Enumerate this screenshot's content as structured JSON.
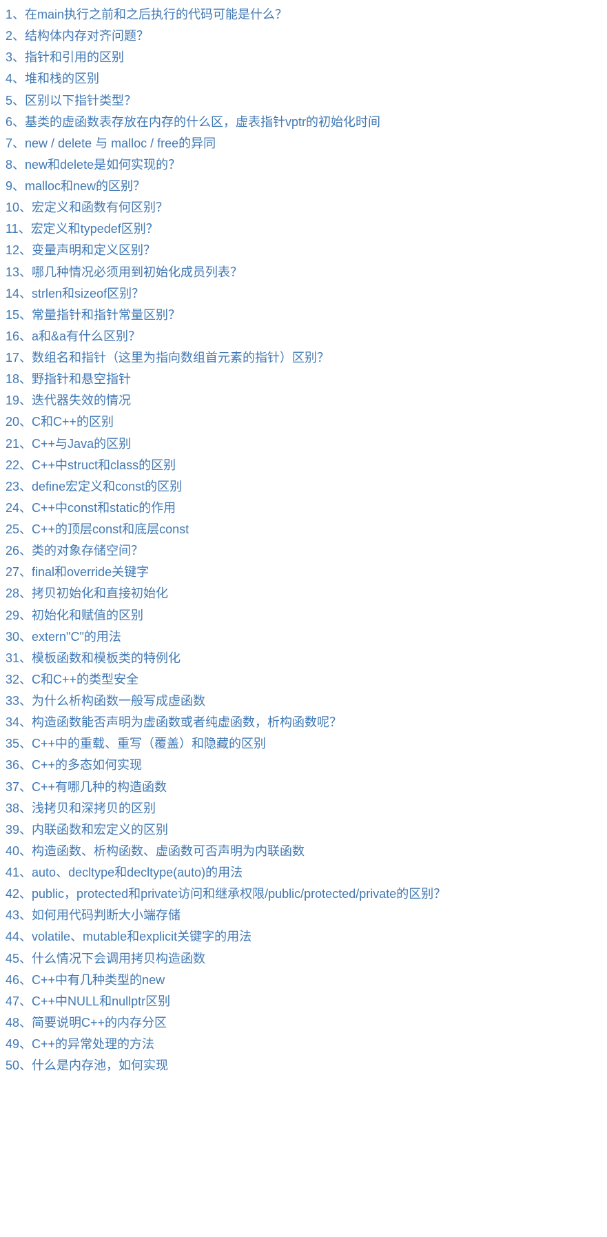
{
  "link_color": "#4179b4",
  "separator": "、",
  "items": [
    {
      "n": "1",
      "t": "在main执行之前和之后执行的代码可能是什么？"
    },
    {
      "n": "2",
      "t": "结构体内存对齐问题？"
    },
    {
      "n": "3",
      "t": "指针和引用的区别"
    },
    {
      "n": "4",
      "t": "堆和栈的区别"
    },
    {
      "n": "5",
      "t": "区别以下指针类型？"
    },
    {
      "n": "6",
      "t": "基类的虚函数表存放在内存的什么区，虚表指针vptr的初始化时间"
    },
    {
      "n": "7",
      "t": "new / delete 与 malloc / free的异同"
    },
    {
      "n": "8",
      "t": "new和delete是如何实现的？"
    },
    {
      "n": "9",
      "t": "malloc和new的区别？"
    },
    {
      "n": "10",
      "t": "宏定义和函数有何区别？"
    },
    {
      "n": "11",
      "t": "宏定义和typedef区别？"
    },
    {
      "n": "12",
      "t": "变量声明和定义区别？"
    },
    {
      "n": "13",
      "t": "哪几种情况必须用到初始化成员列表？"
    },
    {
      "n": "14",
      "t": "strlen和sizeof区别？"
    },
    {
      "n": "15",
      "t": "常量指针和指针常量区别？"
    },
    {
      "n": "16",
      "t": "a和&a有什么区别？"
    },
    {
      "n": "17",
      "t": "数组名和指针（这里为指向数组首元素的指针）区别？"
    },
    {
      "n": "18",
      "t": "野指针和悬空指针"
    },
    {
      "n": "19",
      "t": "迭代器失效的情况"
    },
    {
      "n": "20",
      "t": "C和C++的区别"
    },
    {
      "n": "21",
      "t": "C++与Java的区别"
    },
    {
      "n": "22",
      "t": "C++中struct和class的区别"
    },
    {
      "n": "23",
      "t": "define宏定义和const的区别"
    },
    {
      "n": "24",
      "t": "C++中const和static的作用"
    },
    {
      "n": "25",
      "t": "C++的顶层const和底层const"
    },
    {
      "n": "26",
      "t": "类的对象存储空间？"
    },
    {
      "n": "27",
      "t": "final和override关键字"
    },
    {
      "n": "28",
      "t": "拷贝初始化和直接初始化"
    },
    {
      "n": "29",
      "t": "初始化和赋值的区别"
    },
    {
      "n": "30",
      "t": "extern\"C\"的用法"
    },
    {
      "n": "31",
      "t": "模板函数和模板类的特例化"
    },
    {
      "n": "32",
      "t": "C和C++的类型安全"
    },
    {
      "n": "33",
      "t": "为什么析构函数一般写成虚函数"
    },
    {
      "n": "34",
      "t": "构造函数能否声明为虚函数或者纯虚函数，析构函数呢？"
    },
    {
      "n": "35",
      "t": "C++中的重载、重写（覆盖）和隐藏的区别"
    },
    {
      "n": "36",
      "t": "C++的多态如何实现"
    },
    {
      "n": "37",
      "t": "C++有哪几种的构造函数"
    },
    {
      "n": "38",
      "t": "浅拷贝和深拷贝的区别"
    },
    {
      "n": "39",
      "t": "内联函数和宏定义的区别"
    },
    {
      "n": "40",
      "t": "构造函数、析构函数、虚函数可否声明为内联函数"
    },
    {
      "n": "41",
      "t": "auto、decltype和decltype(auto)的用法"
    },
    {
      "n": "42",
      "t": "public，protected和private访问和继承权限/public/protected/private的区别？"
    },
    {
      "n": "43",
      "t": "如何用代码判断大小端存储"
    },
    {
      "n": "44",
      "t": "volatile、mutable和explicit关键字的用法"
    },
    {
      "n": "45",
      "t": "什么情况下会调用拷贝构造函数"
    },
    {
      "n": "46",
      "t": "C++中有几种类型的new"
    },
    {
      "n": "47",
      "t": "C++中NULL和nullptr区别"
    },
    {
      "n": "48",
      "t": "简要说明C++的内存分区"
    },
    {
      "n": "49",
      "t": "C++的异常处理的方法"
    },
    {
      "n": "50",
      "t": "什么是内存池，如何实现"
    }
  ]
}
